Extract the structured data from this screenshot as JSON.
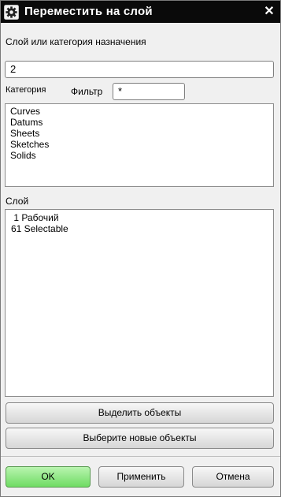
{
  "window": {
    "title": "Переместить на слой",
    "close_glyph": "✕"
  },
  "destination": {
    "label": "Слой или категория назначения",
    "value": "2"
  },
  "category": {
    "label": "Категория",
    "filter_label": "Фильтр",
    "filter_value": "*",
    "items": [
      "Curves",
      "Datums",
      "Sheets",
      "Sketches",
      "Solids"
    ]
  },
  "layer": {
    "label": "Слой",
    "items": [
      " 1 Рабочий",
      "61 Selectable"
    ]
  },
  "actions": {
    "select_objects": "Выделить объекты",
    "select_new_objects": "Выберите новые объекты"
  },
  "footer": {
    "ok": "OK",
    "apply": "Применить",
    "cancel": "Отмена"
  },
  "colors": {
    "titlebar": "#0a0a0a",
    "ok_button": "#6fdc63"
  }
}
